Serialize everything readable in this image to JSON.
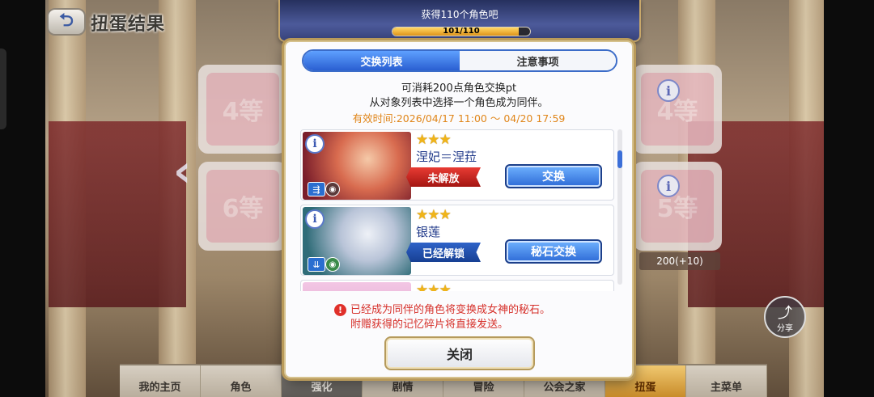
{
  "screen": {
    "title": "扭蛋结果"
  },
  "progress": {
    "label": "获得110个角色吧",
    "text": "101/110",
    "fraction": 0.918
  },
  "background": {
    "card_ranks": [
      "4等",
      "6等",
      "4等",
      "5等"
    ],
    "right_cost": "200(+10)",
    "share_label": "分享"
  },
  "dialog": {
    "tabs": [
      {
        "label": "交换列表",
        "active": true
      },
      {
        "label": "注意事项",
        "active": false
      }
    ],
    "desc_line1": "可消耗200点角色交换pt",
    "desc_line2": "从对象列表中选择一个角色成为同伴。",
    "validity": "有效时间:2026/04/17 11:00 ～ 04/20 17:59",
    "characters": [
      {
        "stars": "★★★",
        "name": "涅妃＝涅菈",
        "status": "未解放",
        "status_type": "locked",
        "action": "交换"
      },
      {
        "stars": "★★★",
        "name": "银莲",
        "status": "已经解锁",
        "status_type": "unlocked",
        "action": "秘石交换"
      },
      {
        "stars": "★★★",
        "name": "",
        "status": "",
        "status_type": "",
        "action": ""
      }
    ],
    "notice_line1": "已经成为同伴的角色将变换成女神的秘石。",
    "notice_line2": "附赠获得的记忆碎片将直接发送。",
    "close_label": "关闭"
  },
  "bottom_nav": [
    {
      "label": "我的主页",
      "state": "normal"
    },
    {
      "label": "角色",
      "state": "normal"
    },
    {
      "label": "强化",
      "state": "active"
    },
    {
      "label": "剧情",
      "state": "normal"
    },
    {
      "label": "冒险",
      "state": "normal"
    },
    {
      "label": "公会之家",
      "state": "normal"
    },
    {
      "label": "扭蛋",
      "state": "highlight"
    },
    {
      "label": "主菜单",
      "state": "normal"
    }
  ],
  "icons": {
    "back": "back-arrow-icon",
    "info": "info-icon",
    "share": "share-icon",
    "warning": "warning-icon",
    "left_arrow": "chevron-left-icon"
  },
  "colors": {
    "tab_active": "#2a5fd1",
    "status_locked": "#d3261f",
    "status_unlocked": "#1f4aa8",
    "validity": "#e0861a",
    "notice": "#d6302a",
    "progress_fill": "#f0b030"
  }
}
